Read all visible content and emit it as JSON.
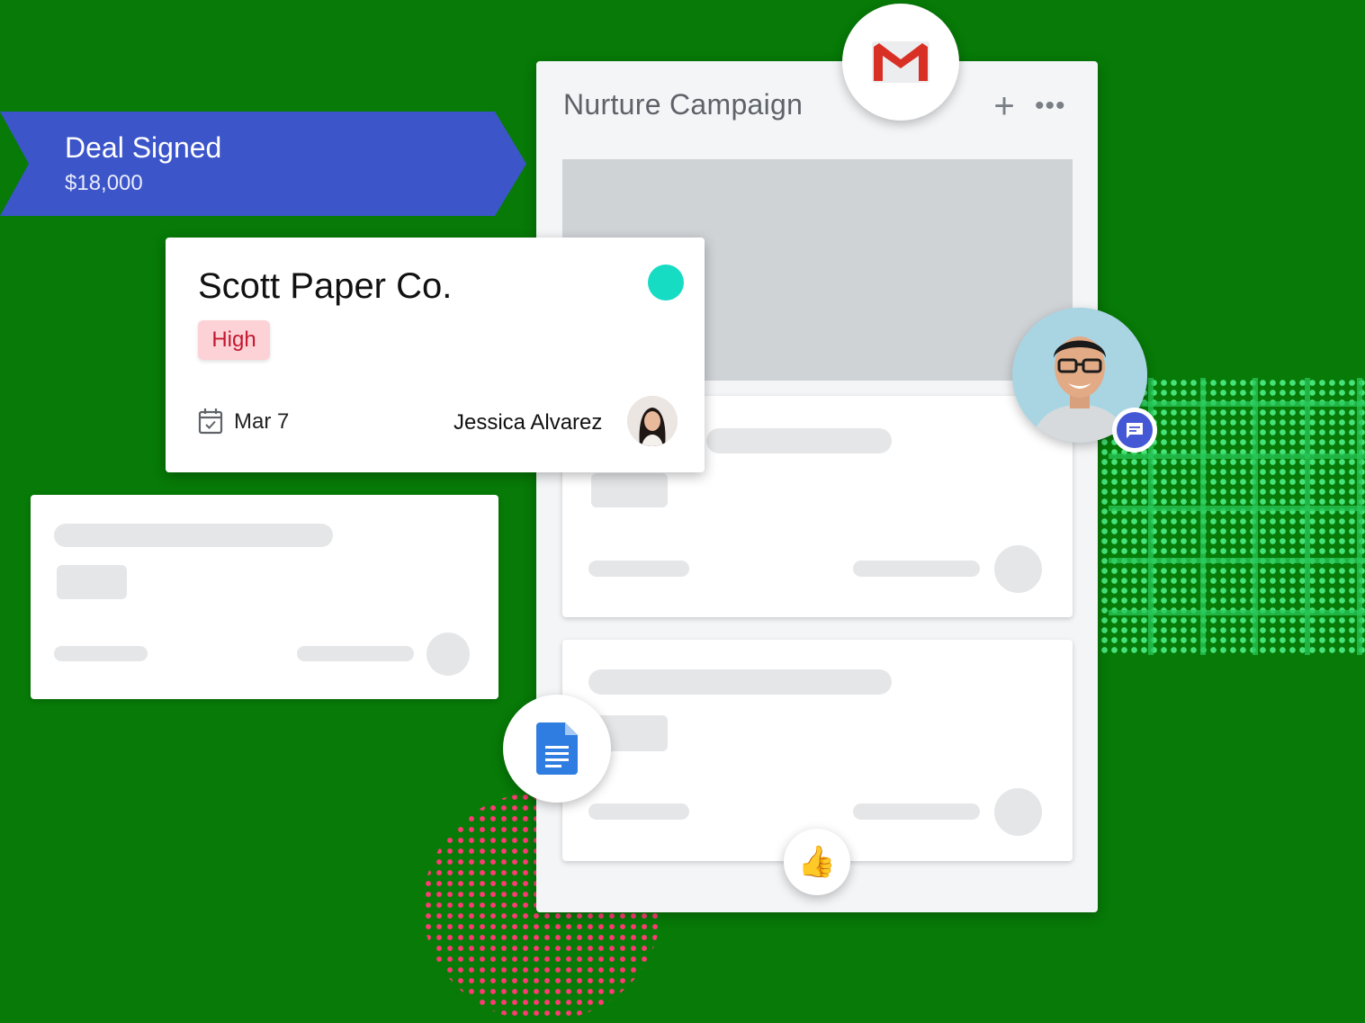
{
  "deal": {
    "title": "Deal Signed",
    "amount": "$18,000"
  },
  "campaign": {
    "title": "Nurture Campaign",
    "add_label": "+",
    "more_label": "•••"
  },
  "deal_card": {
    "company": "Scott Paper Co.",
    "priority": "High",
    "date": "Mar 7",
    "owner": "Jessica Alvarez",
    "status_color": "#16dcc4"
  },
  "icons": {
    "gmail": "gmail-icon",
    "docs": "google-docs-icon",
    "thumbs_up": "👍",
    "chat": "chat-icon",
    "calendar": "calendar-check-icon"
  },
  "colors": {
    "background": "#077a07",
    "ribbon": "#3c55c9",
    "badge_bg": "#fcd2d6",
    "badge_text": "#c3182f"
  }
}
